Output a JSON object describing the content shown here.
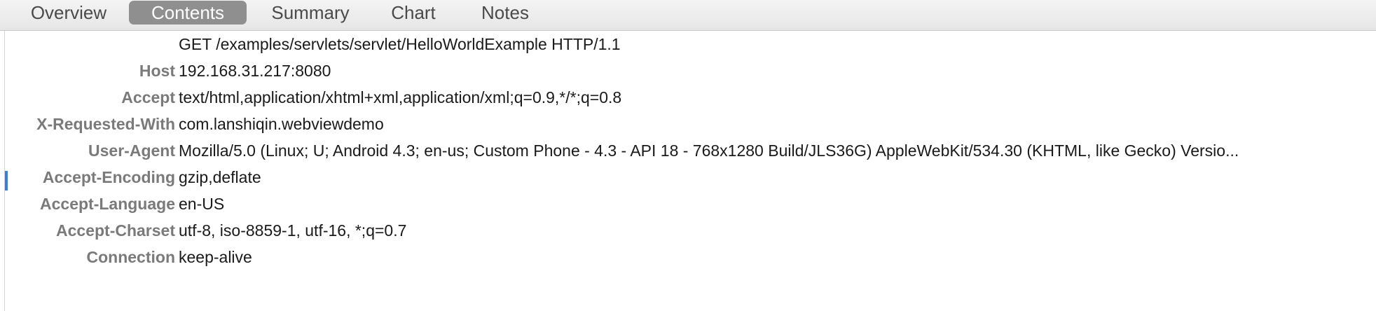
{
  "tabs": [
    {
      "label": "Overview",
      "active": false
    },
    {
      "label": "Contents",
      "active": true
    },
    {
      "label": "Summary",
      "active": false
    },
    {
      "label": "Chart",
      "active": false
    },
    {
      "label": "Notes",
      "active": false
    }
  ],
  "request": {
    "request_line": "GET /examples/servlets/servlet/HelloWorldExample HTTP/1.1",
    "headers": [
      {
        "name": "Host",
        "value": "192.168.31.217:8080"
      },
      {
        "name": "Accept",
        "value": "text/html,application/xhtml+xml,application/xml;q=0.9,*/*;q=0.8"
      },
      {
        "name": "X-Requested-With",
        "value": "com.lanshiqin.webviewdemo"
      },
      {
        "name": "User-Agent",
        "value": "Mozilla/5.0 (Linux; U; Android 4.3; en-us; Custom Phone - 4.3 - API 18 - 768x1280 Build/JLS36G) AppleWebKit/534.30 (KHTML, like Gecko) Versio..."
      },
      {
        "name": "Accept-Encoding",
        "value": "gzip,deflate"
      },
      {
        "name": "Accept-Language",
        "value": "en-US"
      },
      {
        "name": "Accept-Charset",
        "value": "utf-8, iso-8859-1, utf-16, *;q=0.7"
      },
      {
        "name": "Connection",
        "value": "keep-alive"
      }
    ]
  },
  "colors": {
    "active_tab_bg": "#8f8f8f",
    "header_key": "#7a7a7a",
    "selection_marker": "#3b7ddd"
  }
}
